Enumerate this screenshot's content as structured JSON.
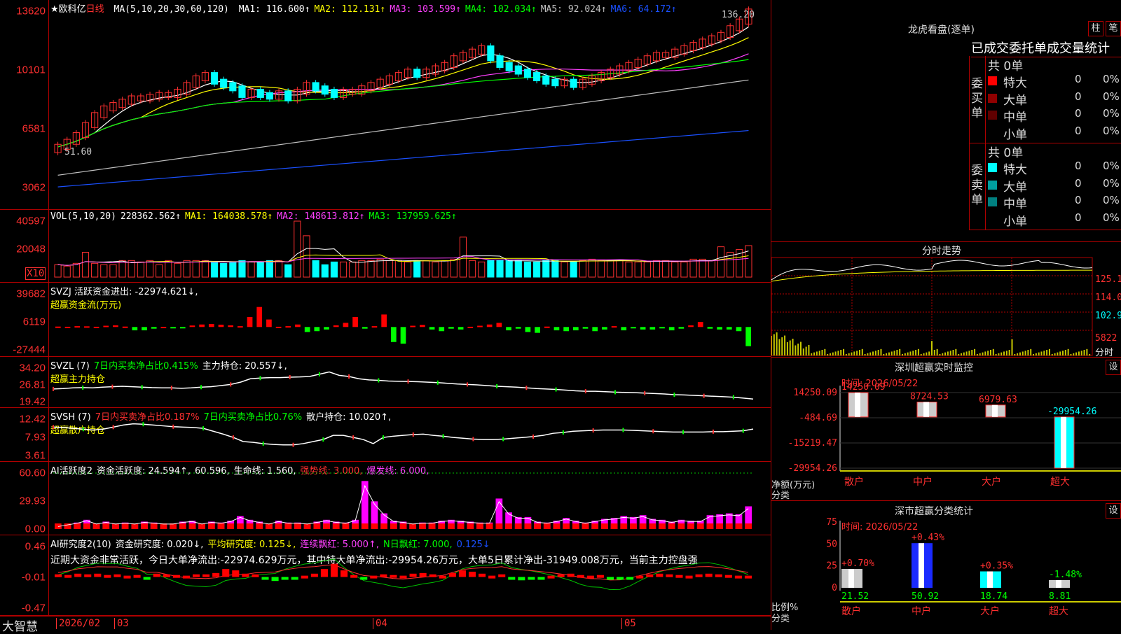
{
  "main": {
    "title_star": "★欧科亿",
    "period": "日线",
    "ma_label": "MA(5,10,20,30,60,120)",
    "ma_values": [
      {
        "text": "MA1: 116.600↑",
        "color": "#ffffff"
      },
      {
        "text": "MA2: 112.131↑",
        "color": "#ffff00"
      },
      {
        "text": "MA3: 103.599↑",
        "color": "#ff40ff"
      },
      {
        "text": "MA4: 102.034↑",
        "color": "#00ff00"
      },
      {
        "text": "MA5: 92.024↑",
        "color": "#c0c0c0"
      },
      {
        "text": "MA6: 64.172↑",
        "color": "#1a50ff"
      }
    ],
    "yticks": [
      "13620",
      "10101",
      "6581",
      "3062"
    ],
    "high_label": "136.20",
    "low_label": "51.60"
  },
  "vol": {
    "label": "VOL(5,10,20)",
    "values": [
      {
        "text": "228362.562↑",
        "color": "#ffffff"
      },
      {
        "text": "MA1: 164038.578↑",
        "color": "#ffff00"
      },
      {
        "text": "MA2: 148613.812↑",
        "color": "#ff40ff"
      },
      {
        "text": "MA3: 137959.625↑",
        "color": "#00ff00"
      }
    ],
    "yticks": [
      "40597",
      "20048"
    ],
    "unit": "X10"
  },
  "svzj": {
    "label": "SVZJ  活跃资金进出: -22974.621↓,",
    "sub": "超赢资金流(万元)",
    "yticks": [
      "39682",
      "6119",
      "-27444"
    ]
  },
  "svzl": {
    "label_a": "SVZL (7)",
    "label_b": "7日内买卖净占比0.415%",
    "label_c": "主力持仓: 20.557↓,",
    "sub": "超赢主力持仓",
    "yticks": [
      "34.20",
      "26.81",
      "19.42"
    ]
  },
  "svsh": {
    "label_a": "SVSH (7)",
    "label_b": "7日内买卖净占比0.187%",
    "label_c": "7日内买卖净占比0.76%",
    "label_d": "散户持仓: 10.020↑,",
    "sub": "超赢散户持仓",
    "yticks": [
      "12.42",
      "7.93",
      "3.61"
    ]
  },
  "ai1": {
    "label_a": "AI活跃度2",
    "label_b": "资金活跃度: 24.594↑,",
    "label_c": "60.596,",
    "label_d": "生命线: 1.560,",
    "label_e": "强势线: 3.000,",
    "label_f": "爆发线: 6.000,",
    "yticks": [
      "60.60",
      "29.93",
      "0.00"
    ]
  },
  "ai2": {
    "label_a": "AI研究度2(10)",
    "label_b": "资金研究度: 0.020↓,",
    "label_c": "平均研究度: 0.125↓,",
    "label_d": "连续飘红: 5.000↑,",
    "label_e": "N日飘红: 7.000,",
    "label_f": "0.125↓",
    "note": "近期大资金非常活跃，今日大单净流出:-22974.629万元，其中特大单净流出:-29954.26万元，大单5日累计净出-31949.008万元，当前主力控盘强",
    "yticks": [
      "0.46",
      "-0.01",
      "-0.47"
    ]
  },
  "xaxis": {
    "brand": "大智慧",
    "labels": [
      "2026/02",
      "03",
      "04",
      "05"
    ]
  },
  "longhu": {
    "title": "龙虎看盘(逐单)",
    "btn1": "柱",
    "btn2": "笔",
    "stats_title": "已成交委托单成交量统计",
    "buy_label": "委买单",
    "sell_label": "委卖单",
    "buy_total": "共 0单",
    "sell_total": "共 0单",
    "buy_rows": [
      {
        "name": "特大",
        "count": "0",
        "pct": "0%",
        "color": "#ff0000"
      },
      {
        "name": "大单",
        "count": "0",
        "pct": "0%",
        "color": "#900000"
      },
      {
        "name": "中单",
        "count": "0",
        "pct": "0%",
        "color": "#600000"
      },
      {
        "name": "小单",
        "count": "0",
        "pct": "0%",
        "color": "#000000"
      }
    ],
    "sell_rows": [
      {
        "name": "特大",
        "count": "0",
        "pct": "0%",
        "color": "#00ffff"
      },
      {
        "name": "大单",
        "count": "0",
        "pct": "0%",
        "color": "#00a0a0"
      },
      {
        "name": "中单",
        "count": "0",
        "pct": "0%",
        "color": "#008080"
      },
      {
        "name": "小单",
        "count": "0",
        "pct": "0%",
        "color": "#000000"
      }
    ]
  },
  "intraday": {
    "title": "分时走势",
    "yticks": [
      {
        "text": "125.1",
        "color": "#ff3030"
      },
      {
        "text": "114.0",
        "color": "#ff3030"
      },
      {
        "text": "102.9",
        "color": "#00ffff"
      },
      {
        "text": "5822",
        "color": "#ff3030"
      },
      {
        "text": "分时",
        "color": "#e0e0e0"
      }
    ]
  },
  "sz_monitor": {
    "title": "深圳超赢实时监控",
    "btn": "设",
    "time": "时间: 2026/05/22",
    "yticks": [
      "14250.09",
      "-484.69",
      "-15219.47",
      "-29954.26"
    ],
    "ylabel1": "净额(万元)",
    "ylabel2": "分类",
    "bars": [
      {
        "cat": "散户",
        "value": 14250.09,
        "label": "14250.09"
      },
      {
        "cat": "中户",
        "value": 8724.53,
        "label": "8724.53"
      },
      {
        "cat": "大户",
        "value": 6979.63,
        "label": "6979.63"
      },
      {
        "cat": "超大",
        "value": -29954.26,
        "label": "-29954.26"
      }
    ]
  },
  "sz_class": {
    "title": "深市超赢分类统计",
    "btn": "设",
    "time": "时间: 2026/05/22",
    "yticks": [
      "75",
      "50",
      "25",
      "0"
    ],
    "ylabel1": "比例%",
    "ylabel2": "分类",
    "bars": [
      {
        "cat": "散户",
        "value": 21.52,
        "label": "21.52",
        "change": "+0.70%"
      },
      {
        "cat": "中户",
        "value": 50.92,
        "label": "50.92",
        "change": "+0.43%"
      },
      {
        "cat": "大户",
        "value": 18.74,
        "label": "18.74",
        "change": "+0.35%"
      },
      {
        "cat": "超大",
        "value": 8.81,
        "label": "8.81",
        "change": "-1.48%"
      }
    ]
  },
  "chart_data": [
    {
      "type": "candlestick",
      "title": "欧科亿 日线",
      "ylim": [
        30.62,
        136.2
      ],
      "yticks": [
        136.2,
        101.01,
        65.81,
        30.62
      ],
      "high": 136.2,
      "low": 51.6,
      "close_series": [
        55,
        58,
        62,
        68,
        74,
        78,
        80,
        82,
        84,
        84,
        85,
        86,
        86,
        88,
        92,
        96,
        98,
        94,
        92,
        90,
        86,
        88,
        86,
        85,
        87,
        84,
        88,
        92,
        90,
        88,
        86,
        88,
        88,
        90,
        92,
        94,
        96,
        98,
        100,
        98,
        100,
        102,
        104,
        108,
        110,
        112,
        114,
        108,
        104,
        102,
        100,
        98,
        96,
        94,
        93,
        94,
        92,
        94,
        96,
        98,
        100,
        102,
        104,
        106,
        108,
        110,
        110,
        112,
        114,
        116,
        118,
        120,
        122,
        126,
        130,
        136
      ]
    },
    {
      "type": "bar",
      "title": "VOL",
      "ylim": [
        0,
        40597
      ],
      "values": [
        9000,
        8000,
        10000,
        18000,
        10000,
        9000,
        9000,
        12000,
        12000,
        11000,
        12000,
        9000,
        12000,
        10000,
        12000,
        12000,
        12000,
        11000,
        10000,
        11000,
        12000,
        11000,
        11000,
        12000,
        12000,
        9000,
        40597,
        30000,
        12000,
        9000,
        11000,
        11000,
        11000,
        12000,
        12000,
        13000,
        12000,
        12000,
        11000,
        12000,
        12000,
        11000,
        12000,
        13000,
        29000,
        12000,
        11000,
        12000,
        12000,
        12000,
        12000,
        11000,
        11000,
        12000,
        12000,
        11000,
        11000,
        12000,
        13000,
        12000,
        12000,
        12000,
        11000,
        11000,
        11000,
        12000,
        12000,
        11000,
        11000,
        13000,
        13000,
        12000,
        22000,
        18000,
        20000,
        22836
      ]
    },
    {
      "type": "bar",
      "title": "超赢资金流(万元)",
      "ylim": [
        -27444,
        39682
      ],
      "values": [
        500,
        300,
        1000,
        800,
        300,
        1500,
        2000,
        500,
        -4000,
        -4000,
        -2000,
        200,
        -100,
        -200,
        1800,
        3000,
        3500,
        2800,
        2000,
        1000,
        12000,
        24000,
        9000,
        300,
        1000,
        3000,
        -6000,
        -5000,
        -3000,
        2000,
        5000,
        12000,
        -2000,
        1000,
        15000,
        -18000,
        -20000,
        1500,
        2500,
        -3000,
        -5000,
        -2000,
        -3000,
        300,
        1500,
        3000,
        5000,
        -4000,
        -2000,
        -6000,
        -7000,
        500,
        -4000,
        -5000,
        -4000,
        -2000,
        -5000,
        -3000,
        1000,
        -4000,
        -1000,
        -3000,
        -3000,
        -1000,
        -4000,
        -2000,
        2000,
        6000,
        -2000,
        -3000,
        -3000,
        -5000,
        -22974
      ]
    },
    {
      "type": "line",
      "title": "超赢主力持仓",
      "ylim": [
        19.42,
        34.2
      ],
      "values": [
        25,
        25.2,
        25.5,
        25.6,
        25.5,
        25.8,
        26,
        26.2,
        26,
        25.8,
        25.6,
        25.5,
        25.5,
        25.3,
        25.5,
        25.8,
        26,
        26.5,
        27,
        28,
        29.5,
        29.8,
        30,
        30,
        30.2,
        30.3,
        30.5,
        31.5,
        32.5,
        31,
        30.5,
        29.5,
        29,
        28.8,
        28.5,
        28.4,
        28.3,
        28.2,
        28,
        27.8,
        27.5,
        27.2,
        27,
        26.8,
        26.5,
        26.2,
        26,
        25.8,
        25.5,
        25.2,
        25,
        24.8,
        24.5,
        24.2,
        24,
        24,
        23.8,
        23.6,
        23.5,
        23.4,
        23.2,
        23,
        22.8,
        22.5,
        22.4,
        22.2,
        22,
        21.8,
        21.6,
        21.4,
        21,
        20.557
      ]
    },
    {
      "type": "line",
      "title": "超赢散户持仓",
      "ylim": [
        3.61,
        12.42
      ],
      "values": [
        10.5,
        10.4,
        10.2,
        10,
        9.8,
        10,
        10.5,
        11,
        11.3,
        11.2,
        11,
        10.8,
        10.6,
        10.5,
        10.4,
        10.2,
        9.5,
        8.8,
        8,
        7,
        6.8,
        6.5,
        6.3,
        6.2,
        6.2,
        6.5,
        7,
        7.5,
        8.5,
        8.5,
        8,
        7.5,
        6.5,
        8,
        8.3,
        8.5,
        8.7,
        8.8,
        8.5,
        8.3,
        8,
        7.8,
        7.6,
        7.5,
        7.5,
        7.6,
        7.8,
        8,
        8.2,
        8.5,
        9,
        9.2,
        9.5,
        9.6,
        9.7,
        9.8,
        9.8,
        9.8,
        9.7,
        9.6,
        9.5,
        9.4,
        9.3,
        9.3,
        9.3,
        9.3,
        9.4,
        9.4,
        9.5,
        9.6,
        10.02
      ]
    },
    {
      "type": "bar",
      "title": "AI活跃度2",
      "ylim": [
        0,
        60.6
      ],
      "values": [
        3,
        5,
        7,
        10,
        6,
        8,
        6,
        7,
        6,
        8,
        7,
        6,
        6,
        8,
        9,
        6,
        8,
        7,
        9,
        14,
        10,
        8,
        6,
        9,
        7,
        7,
        6,
        8,
        10,
        8,
        7,
        10,
        52,
        30,
        17,
        9,
        8,
        6,
        7,
        7,
        9,
        10,
        9,
        8,
        7,
        7,
        33,
        18,
        13,
        13,
        8,
        7,
        9,
        12,
        9,
        7,
        9,
        11,
        12,
        14,
        13,
        15,
        11,
        10,
        8,
        10,
        9,
        9,
        15,
        16,
        17,
        16,
        24.594
      ]
    },
    {
      "type": "bar",
      "title": "AI研究度2(10)",
      "ylim": [
        -0.47,
        0.46
      ],
      "values": [
        0.04,
        0.03,
        0.05,
        0.04,
        0.05,
        0.03,
        0.04,
        0.02,
        0.03,
        -0.02,
        0.05,
        0.04,
        0.03,
        0.02,
        0.04,
        0.04,
        0.06,
        0.12,
        0.1,
        0.05,
        0.04,
        -0.01,
        -0.06,
        -0.03,
        -0.01,
        0.02,
        0.05,
        0.12,
        0.2,
        0.1,
        0.03,
        -0.01,
        0.02,
        0.04,
        0.03,
        0.02,
        0.05,
        0.06,
        0.04,
        0.02,
        0.06,
        0.1,
        0.08,
        0.05,
        0.02,
        0.04,
        -0.04,
        -0.05,
        -0.03,
        -0.01,
        0.02,
        0.04,
        0.05,
        0.03,
        0.02,
        0.03,
        -0.02,
        -0.04,
        -0.02,
        0.02,
        0.04,
        0.05,
        0.04,
        0.03,
        0.02,
        0.04,
        0.05,
        0.04,
        0.03,
        0.02,
        0.02
      ]
    }
  ]
}
